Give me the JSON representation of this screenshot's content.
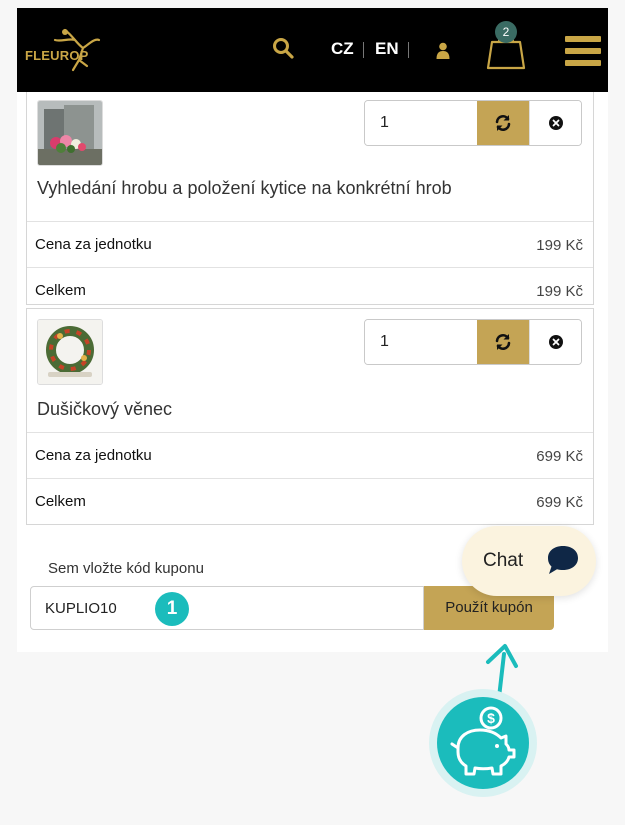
{
  "header": {
    "logo_text": "FLEUROP",
    "lang_cz": "CZ",
    "lang_en": "EN",
    "cart_count": "2"
  },
  "cart": {
    "items": [
      {
        "name": "Vyhledání hrobu a položení kytice na konkrétní hrob",
        "quantity": "1",
        "unit_price_label": "Cena za jednotku",
        "unit_price": "199 Kč",
        "total_label": "Celkem",
        "total": "199 Kč"
      },
      {
        "name": "Dušičkový věnec",
        "quantity": "1",
        "unit_price_label": "Cena za jednotku",
        "unit_price": "699 Kč",
        "total_label": "Celkem",
        "total": "699 Kč"
      }
    ]
  },
  "coupon": {
    "label": "Sem vložte kód kuponu",
    "value": "KUPLIO10",
    "step_number": "1",
    "apply_label": "Použít kupón"
  },
  "chat": {
    "label": "Chat"
  },
  "colors": {
    "brand_gold": "#c4a455",
    "header_bg": "#000000",
    "accent_teal": "#1bbcbc"
  }
}
